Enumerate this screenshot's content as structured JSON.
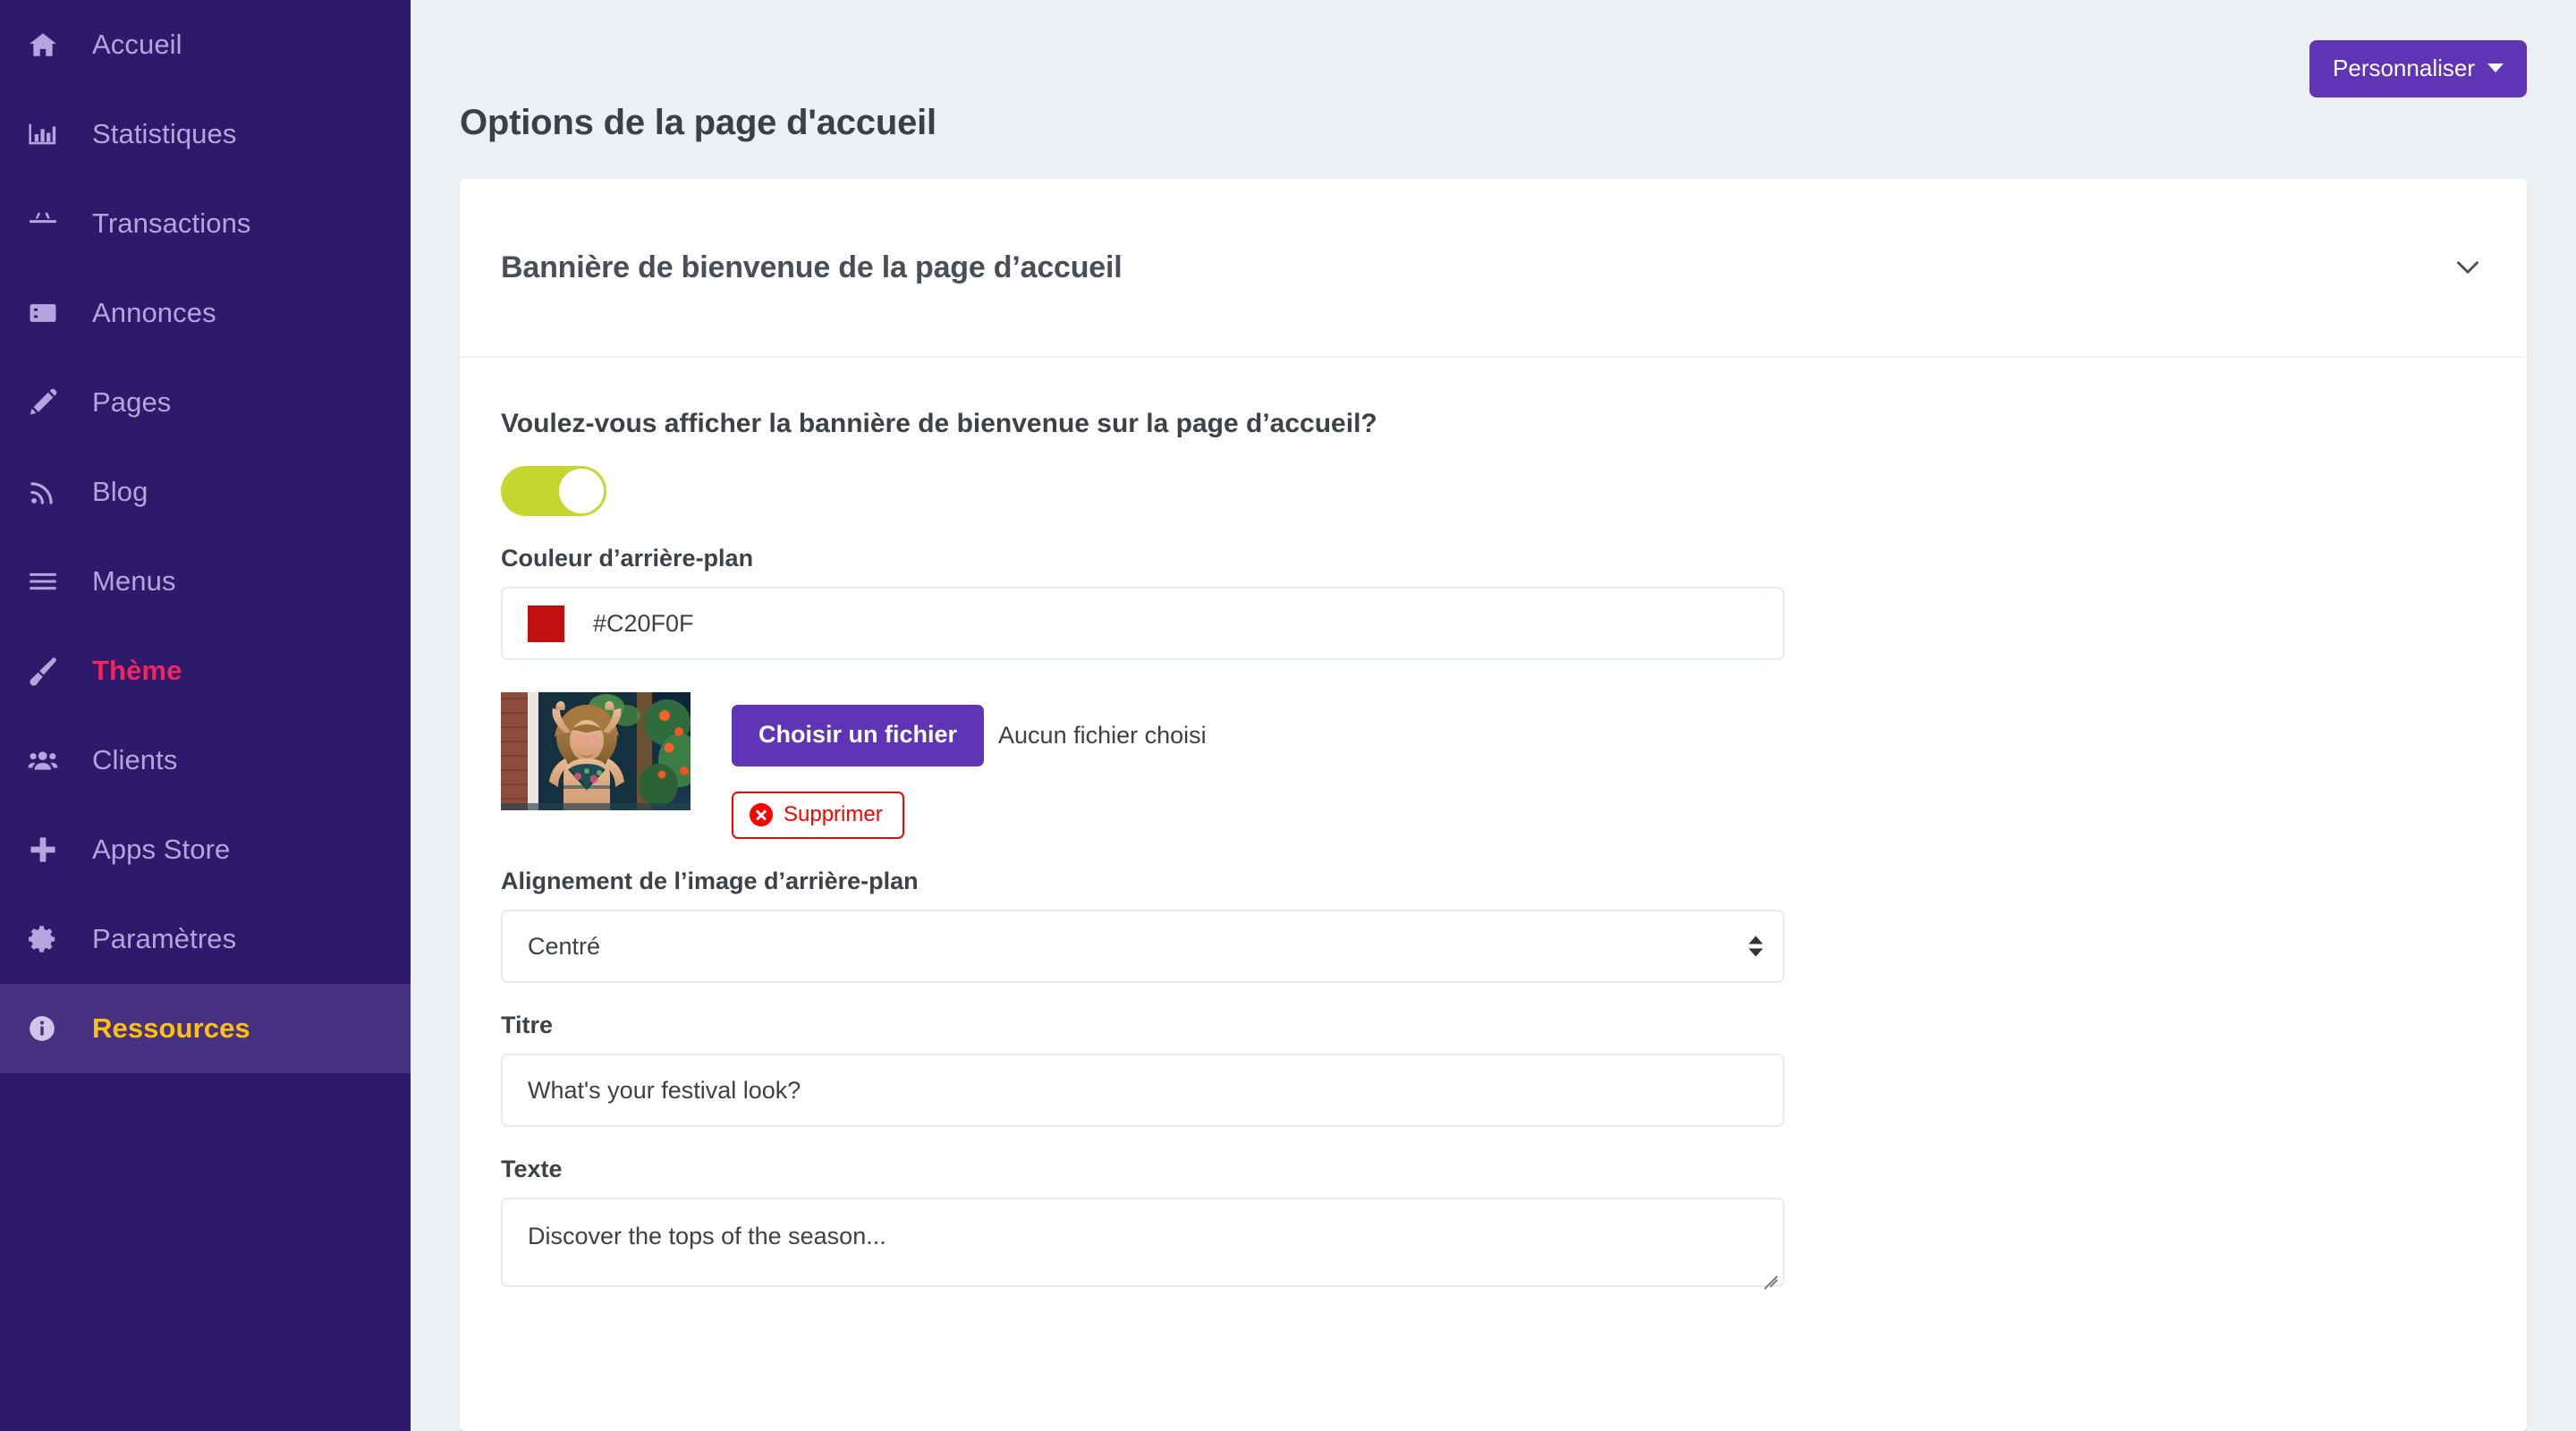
{
  "sidebar": {
    "items": [
      {
        "label": "Accueil",
        "icon": "home-icon",
        "state": "normal"
      },
      {
        "label": "Statistiques",
        "icon": "bar-chart-icon",
        "state": "normal"
      },
      {
        "label": "Transactions",
        "icon": "basket-icon",
        "state": "normal"
      },
      {
        "label": "Annonces",
        "icon": "list-icon",
        "state": "normal"
      },
      {
        "label": "Pages",
        "icon": "pencil-icon",
        "state": "normal"
      },
      {
        "label": "Blog",
        "icon": "rss-icon",
        "state": "normal"
      },
      {
        "label": "Menus",
        "icon": "hamburger-icon",
        "state": "normal"
      },
      {
        "label": "Thème",
        "icon": "paintbrush-icon",
        "state": "accent"
      },
      {
        "label": "Clients",
        "icon": "users-icon",
        "state": "normal"
      },
      {
        "label": "Apps Store",
        "icon": "plus-icon",
        "state": "normal"
      },
      {
        "label": "Paramètres",
        "icon": "gear-icon",
        "state": "normal"
      },
      {
        "label": "Ressources",
        "icon": "info-icon",
        "state": "active"
      }
    ],
    "colors": {
      "background": "#2D1A6B",
      "active_background": "#473180",
      "label": "#B3A5DD",
      "accent_label": "#F0255F",
      "active_label": "#FFC107"
    }
  },
  "header": {
    "title": "Options de la page d'accueil",
    "customize_button": "Personnaliser",
    "customize_button_color": "#5F35B5"
  },
  "card": {
    "title": "Bannière de bienvenue de la page d’accueil",
    "collapse_icon": "chevron-down-icon"
  },
  "form": {
    "question": "Voulez-vous afficher la bannière de bienvenue sur la page d’accueil?",
    "toggle": {
      "state": "on",
      "on_color": "#C5D62E"
    },
    "background_color": {
      "label": "Couleur d’arrière-plan",
      "value": "#C20F0F",
      "swatch_color": "#C20F0F"
    },
    "file_upload": {
      "choose_button": "Choisir un fichier",
      "no_file_text": "Aucun fichier choisi",
      "delete_button": "Supprimer",
      "delete_icon": "x-circle-icon",
      "thumbnail_alt": "Image d’arrière-plan de la bannière"
    },
    "alignment": {
      "label": "Alignement de l’image d’arrière-plan",
      "value": "Centré"
    },
    "title_field": {
      "label": "Titre",
      "value": "What's your festival look?"
    },
    "text_field": {
      "label": "Texte",
      "value": "Discover the tops of the season..."
    }
  }
}
